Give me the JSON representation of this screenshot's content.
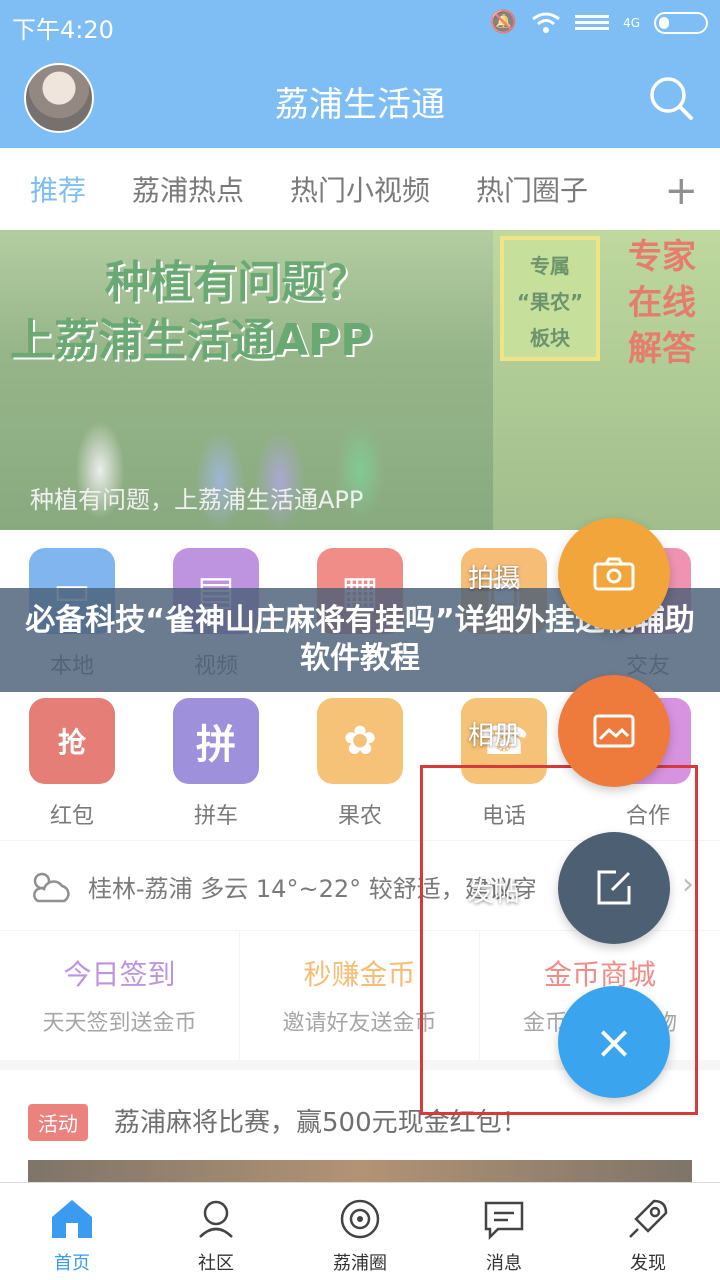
{
  "status_bar": {
    "time": "下午4:20",
    "network": "4G"
  },
  "header": {
    "title": "荔浦生活通"
  },
  "tabs": {
    "items": [
      "推荐",
      "荔浦热点",
      "热门小视频",
      "热门圈子"
    ],
    "add": "+"
  },
  "banner": {
    "headline1": "种植有问题？",
    "headline2": "上荔浦生活通APP",
    "badge": [
      "专属",
      "“果农”",
      "板块"
    ],
    "expert": [
      "专家",
      "在线",
      "解答"
    ],
    "caption": "种植有问题，上荔浦生活通APP"
  },
  "grid": {
    "row1": [
      {
        "label": "本地",
        "color": "#3d8ee8"
      },
      {
        "label": "视频",
        "color": "#9b59d0"
      },
      {
        "label": "",
        "color": "#e8514a"
      },
      {
        "label": "",
        "color": "#f29a2e"
      },
      {
        "label": "交友",
        "color": "#e85a8a"
      }
    ],
    "row2": [
      {
        "label": "红包",
        "color": "#d63a2f",
        "glyph": "抢"
      },
      {
        "label": "拼车",
        "color": "#6a55c8",
        "glyph": "拼"
      },
      {
        "label": "果农",
        "color": "#f0a12e",
        "glyph": "✿"
      },
      {
        "label": "电话",
        "color": "#f0a12e",
        "glyph": "☎"
      },
      {
        "label": "合作",
        "color": "#c45ad0",
        "glyph": "★"
      }
    ]
  },
  "weather": {
    "text": "桂林-荔浦 多云 14°~22° 较舒适，建议穿",
    "arrow": "›"
  },
  "promos": [
    {
      "title": "今日签到",
      "subtitle": "天天签到送金币",
      "color": "#9b59d0"
    },
    {
      "title": "秒赚金币",
      "subtitle": "邀请好友送金币",
      "color": "#f29a2e"
    },
    {
      "title": "金币商城",
      "subtitle": "金币兑换好礼物",
      "color": "#e8514a"
    }
  ],
  "news": {
    "tag": "活动",
    "title": "荔浦麻将比赛，赢500元现金红包！"
  },
  "watermark": {
    "text": "必备科技“雀神山庄麻将有挂吗”详细外挂透视辅助软件教程"
  },
  "fab_menu": {
    "shoot_label": "拍摄",
    "album_label": "相册",
    "post_label": "发帖",
    "close_glyph": "×",
    "colors": {
      "shoot": "#f2a53a",
      "album": "#ee7a3c",
      "post": "#4d5f73",
      "close": "#3aa5ee"
    }
  },
  "bottom_nav": [
    "首页",
    "社区",
    "荔浦圈",
    "消息",
    "发现"
  ]
}
